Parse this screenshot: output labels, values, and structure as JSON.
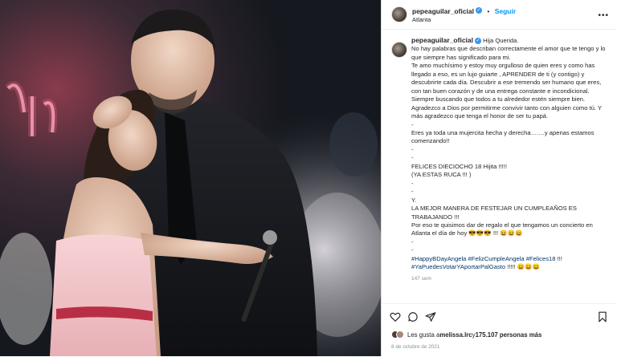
{
  "post": {
    "username": "pepeaguilar_oficial",
    "follow_label": "Seguir",
    "location": "Atlanta",
    "separator": "•",
    "verified_glyph": "✓",
    "caption_lines": [
      "Hija Querida.",
      "No hay palabras que describan correctamente el amor que te tengo y lo que siempre has significado para mi.",
      "Te amo muchísimo y estoy muy orgulloso de quien eres y como has llegado a eso, es un lujo guiarte , APRENDER de ti (y contigo) y descubrirte cada día. Descubrir a ese tremendo ser humano que eres, con tan buen corazón y de una entrega constante e incondicional. Siempre buscando que todos a tu alrededor estén siempre bien.",
      "Agradezco a Dios por permitirme convivir tanto con alguien como tú. Y más agradezco que tenga el honor de ser tu papá.",
      "-",
      "Eres ya toda una mujercita hecha y derecha…….y apenas estamos comenzando!!",
      "-",
      "-",
      "FELICES DIECIOCHO 18 Hijita !!!!!",
      "(YA ESTAS RUCA !!! )",
      "-",
      "-",
      "Y.",
      "LA MEJOR MANERA DE FESTEJAR UN CUMPLEAÑOS ES TRABAJANDO !!!",
      "Por eso te quisimos dar de regalo el que tengamos un concierto en Atlanta el día de hoy 😎😎😎 !!! 😄😄😄",
      "-",
      "-"
    ],
    "hashtags_line1": [
      "#HappyBDayAngela",
      "#FelizCumpleAngela",
      "#Felices18"
    ],
    "hashtags_line1_suffix": " !!!",
    "hashtags_line2": [
      "#YaPuedesVotarYAportarPalGasto"
    ],
    "hashtags_line2_suffix": " !!!!! 😄😄😄",
    "time_ago": "147 sem",
    "likes_prefix": "Les gusta a ",
    "likes_user": "melissa.lrc",
    "likes_middle": " y ",
    "likes_count": "175.107 personas más",
    "date": "8 de octubre de 2021"
  },
  "icons": {
    "like": "heart-icon",
    "comment": "comment-icon",
    "share": "share-icon",
    "save": "bookmark-icon",
    "more": "more-icon",
    "verified": "verified-badge-icon"
  },
  "colors": {
    "link_blue": "#0095f6",
    "hashtag": "#00376b",
    "verified": "#3897f0",
    "muted": "#8e8e8e"
  }
}
